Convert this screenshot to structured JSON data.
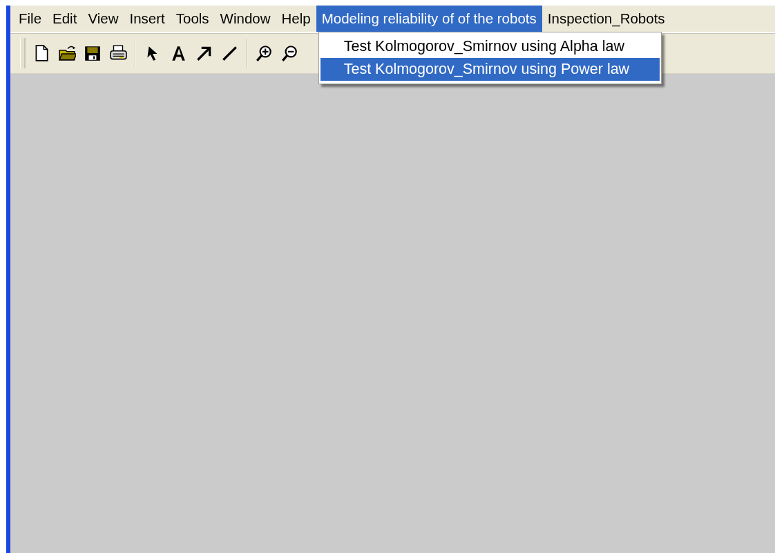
{
  "menu_bar": [
    {
      "label": "File",
      "selected": false
    },
    {
      "label": "Edit",
      "selected": false
    },
    {
      "label": "View",
      "selected": false
    },
    {
      "label": "Insert",
      "selected": false
    },
    {
      "label": "Tools",
      "selected": false
    },
    {
      "label": "Window",
      "selected": false
    },
    {
      "label": "Help",
      "selected": false
    },
    {
      "label": "Modeling reliability of of the robots",
      "selected": true,
      "dropdown": [
        {
          "label": "Test Kolmogorov_Smirnov using Alpha law",
          "selected": false
        },
        {
          "label": "Test Kolmogorov_Smirnov using Power law",
          "selected": true
        }
      ]
    },
    {
      "label": "Inspection_Robots",
      "selected": false
    }
  ],
  "toolbar": [
    {
      "kind": "new"
    },
    {
      "kind": "open"
    },
    {
      "kind": "save"
    },
    {
      "kind": "print"
    },
    {
      "kind": "separator"
    },
    {
      "kind": "pointer"
    },
    {
      "kind": "text"
    },
    {
      "kind": "arrow"
    },
    {
      "kind": "line"
    },
    {
      "kind": "separator"
    },
    {
      "kind": "zoom-in"
    },
    {
      "kind": "zoom-out"
    }
  ]
}
